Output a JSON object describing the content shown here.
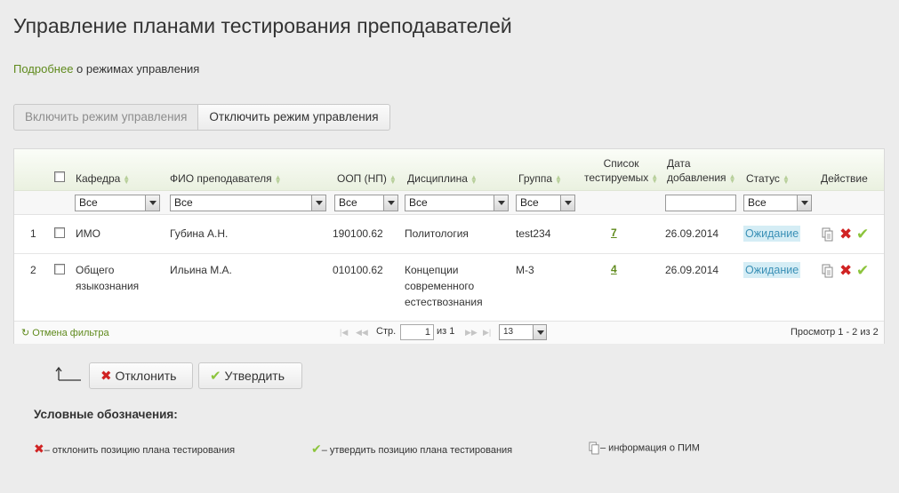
{
  "page": {
    "title": "Управление планами тестирования преподавателей",
    "more_link": "Подробнее",
    "more_text": " о режимах управления"
  },
  "mode_switch": {
    "enable_label": "Включить режим управления",
    "disable_label": "Отключить режим управления"
  },
  "grid": {
    "columns": {
      "department": "Кафедра",
      "teacher": "ФИО преподавателя",
      "oop": "ООП (НП)",
      "discipline": "Дисциплина",
      "group": "Группа",
      "tested_list_1": "Список",
      "tested_list_2": "тестируемых",
      "date_1": "Дата",
      "date_2": "добавления",
      "status": "Статус",
      "action": "Действие"
    },
    "filters": {
      "department": "Все",
      "teacher": "Все",
      "oop": "Все",
      "discipline": "Все",
      "group": "Все",
      "date": "",
      "status": "Все"
    },
    "rows": [
      {
        "num": "1",
        "department": "ИМО",
        "department_2": "",
        "teacher": "Губина А.Н.",
        "oop": "190100.62",
        "discipline": "Политология",
        "discipline_2": "",
        "discipline_3": "",
        "group": "test234",
        "tested_count": "7",
        "date": "26.09.2014",
        "status": "Ожидание"
      },
      {
        "num": "2",
        "department": "Общего",
        "department_2": "языкознания",
        "teacher": "Ильина М.А.",
        "oop": "010100.62",
        "discipline": "Концепции",
        "discipline_2": "современного",
        "discipline_3": "естествознания",
        "group": "М-3",
        "tested_count": "4",
        "date": "26.09.2014",
        "status": "Ожидание"
      }
    ],
    "pager": {
      "reset_filter": "Отмена фильтра",
      "page_label": "Стр.",
      "page_value": "1",
      "of_label": "из 1",
      "page_size": "13",
      "view_info": "Просмотр 1 - 2 из 2"
    }
  },
  "actions": {
    "reject_label": "Отклонить",
    "approve_label": "Утвердить"
  },
  "legend": {
    "title": "Условные обозначения:",
    "reject_text": "– отклонить позицию плана тестирования",
    "approve_text": "– утвердить позицию плана тестирования",
    "info_text": "– информация о ПИМ"
  },
  "colors": {
    "link_green": "#5f8a1c",
    "reject_red": "#d02323",
    "approve_green": "#8cc43c",
    "status_bg": "#d5edf5",
    "status_text": "#3a90b6"
  },
  "icons": {
    "sort": "sort-arrows-icon",
    "reject": "cross-icon",
    "approve": "checkmark-icon",
    "info": "document-icon",
    "return": "return-arrow-icon"
  }
}
